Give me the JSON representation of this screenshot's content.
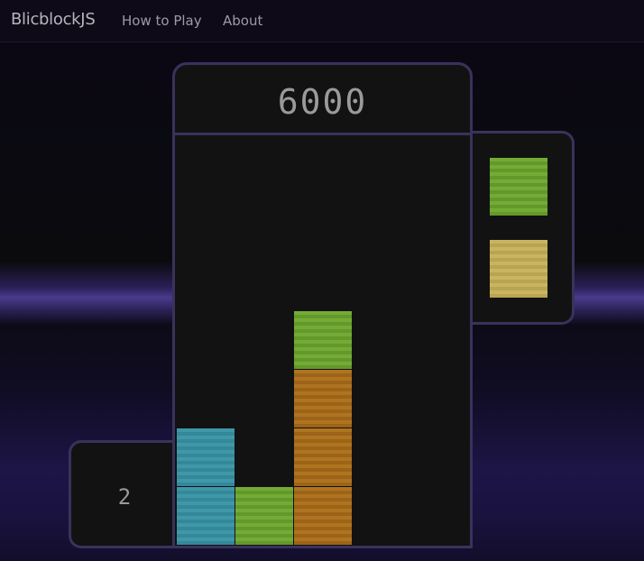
{
  "navbar": {
    "brand": "BlicblockJS",
    "links": [
      "How to Play",
      "About"
    ]
  },
  "game": {
    "score": "6000",
    "level": "2",
    "next_pieces": [
      {
        "color": "green",
        "hex": "#74ab36"
      },
      {
        "color": "yellow",
        "hex": "#c9b462"
      }
    ],
    "board_columns": 5,
    "board": {
      "column_1": [
        "cyan",
        "cyan"
      ],
      "column_2": [
        "green"
      ],
      "column_3": [
        "orange",
        "orange",
        "orange",
        "green"
      ],
      "column_4": [],
      "column_5": []
    }
  },
  "colors": {
    "green": "#74ab36",
    "orange": "#b07420",
    "cyan": "#3e98a8",
    "yellow": "#c9b462",
    "panel_border": "#3a325c",
    "panel_bg": "#121212"
  }
}
